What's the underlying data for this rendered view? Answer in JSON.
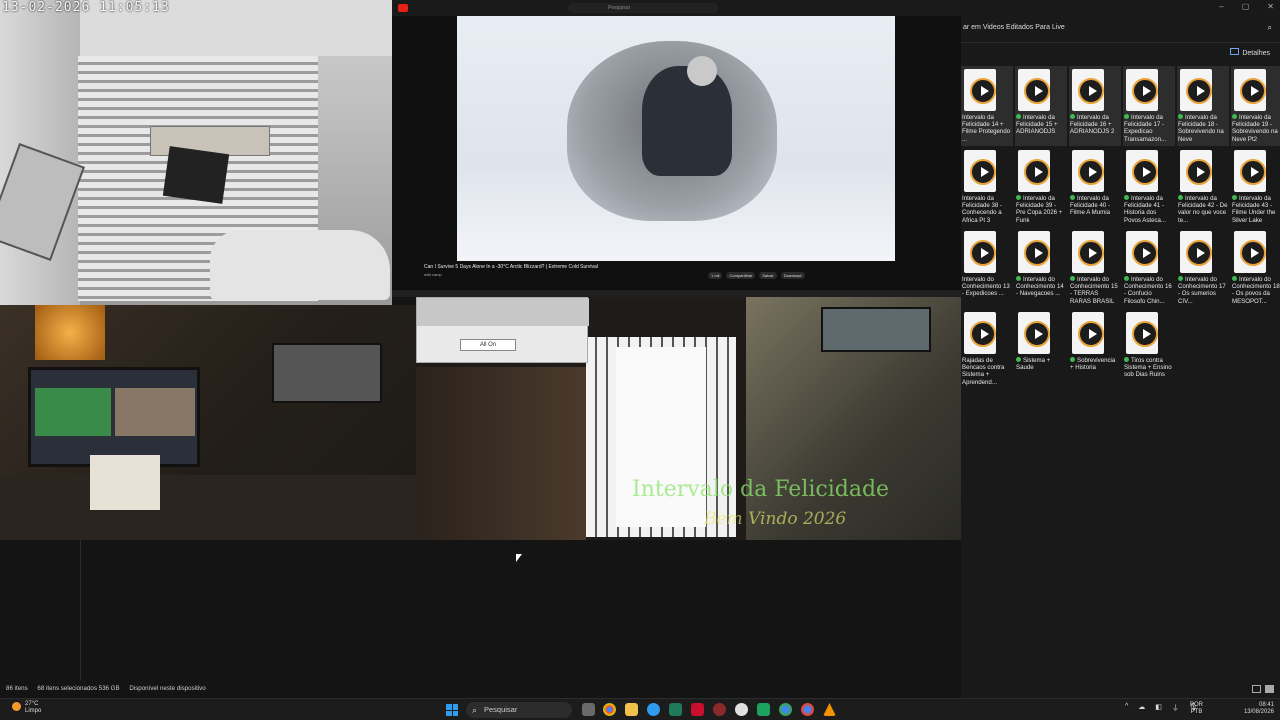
{
  "camera": {
    "timestamp": "13-02-2026 11:05:13"
  },
  "player": {
    "search_placeholder": "Pesquisar",
    "video_title": "Can I Survive 5 Days Alone In a -30°C Arctic Blizzard? | Extreme Cold Survival",
    "channel": "wild camp",
    "actions": [
      "1 mil",
      "Compartilhar",
      "Salvar",
      "Download"
    ]
  },
  "room": {
    "dialog_button": "All On",
    "overlay_line1": "Intervalo da Felicidade",
    "overlay_line2": "Bem Vindo 2026"
  },
  "explorer": {
    "address": "ar em Videos Editados Para Live",
    "details_label": "Detalhes",
    "files": [
      {
        "name": "Intervalo da Felicidade 14 + Filme Protegendo ...",
        "synced": false,
        "selected": true
      },
      {
        "name": "Intervalo da Felicidade 15 + ADRIANODJS",
        "synced": true,
        "selected": true
      },
      {
        "name": "Intervalo da Felicidade 16 + ADRIANODJS 2",
        "synced": true,
        "selected": true
      },
      {
        "name": "Intervalo da Felicidade 17 - Expedicao Transamazon...",
        "synced": true,
        "selected": true
      },
      {
        "name": "Intervalo da Felicidade 18 - Sobrevivendo na Neve",
        "synced": true,
        "selected": true
      },
      {
        "name": "Intervalo da Felicidade 19 - Sobrevivendo na Neve Pt2",
        "synced": true,
        "selected": true
      },
      {
        "name": "Intervalo da Felicidade 38 - Conhecendo a Africa Pt 3",
        "synced": false,
        "selected": false
      },
      {
        "name": "Intervalo da Felicidade 39 - Pre Copa 2026 + Funk",
        "synced": true,
        "selected": false
      },
      {
        "name": "Intervalo da Felicidade 40 - Filme A Mumia",
        "synced": true,
        "selected": false
      },
      {
        "name": "Intervalo da Felicidade 41 - Historia dos Povos Asteca...",
        "synced": true,
        "selected": false
      },
      {
        "name": "Intervalo da Felicidade 42 - De valor no que voce te...",
        "synced": true,
        "selected": false
      },
      {
        "name": "Intervalo da Felicidade 43 - Filme Under the Silver Lake",
        "synced": true,
        "selected": false
      },
      {
        "name": "Intervalo do Conhecimento 13 - Expedicoes ...",
        "synced": false,
        "selected": false
      },
      {
        "name": "Intervalo do Conhecimento 14 - Navegacoes ...",
        "synced": true,
        "selected": false
      },
      {
        "name": "Intervalo do Conhecimento 15 - TERRAS RARAS BRASIL",
        "synced": true,
        "selected": false
      },
      {
        "name": "Intervalo do Conhecimento 16 - Confucio Filosofo Chin...",
        "synced": true,
        "selected": false
      },
      {
        "name": "Intervalo do Conhecimento 17 - Os sumerios CIV...",
        "synced": true,
        "selected": false
      },
      {
        "name": "Intervalo do Conhecimento 18 - Os povos da MESOPOT...",
        "synced": true,
        "selected": false
      },
      {
        "name": "Rajadas de Bencaos contra Sistema + Aprendend...",
        "synced": false,
        "selected": false
      },
      {
        "name": "Sistema + Saude",
        "synced": true,
        "selected": false
      },
      {
        "name": "Sobrevivencia + Historia",
        "synced": true,
        "selected": false
      },
      {
        "name": "Tiros contra Sistema + Ensino sob Dias Ruins",
        "synced": true,
        "selected": false
      }
    ]
  },
  "statusbar": {
    "items_count": "86 itens",
    "selected": "68 itens selecionados 536 GB",
    "availability": "Disponível neste dispositivo"
  },
  "taskbar": {
    "weather_temp": "27°C",
    "weather_desc": "Limpo",
    "search": "Pesquisar",
    "lang": "POR",
    "lang2": "PTB",
    "time": "08:41",
    "date": "13/08/2026",
    "colors": {
      "accent": "#2f9cf0",
      "sync_ok": "#3fb950"
    }
  }
}
